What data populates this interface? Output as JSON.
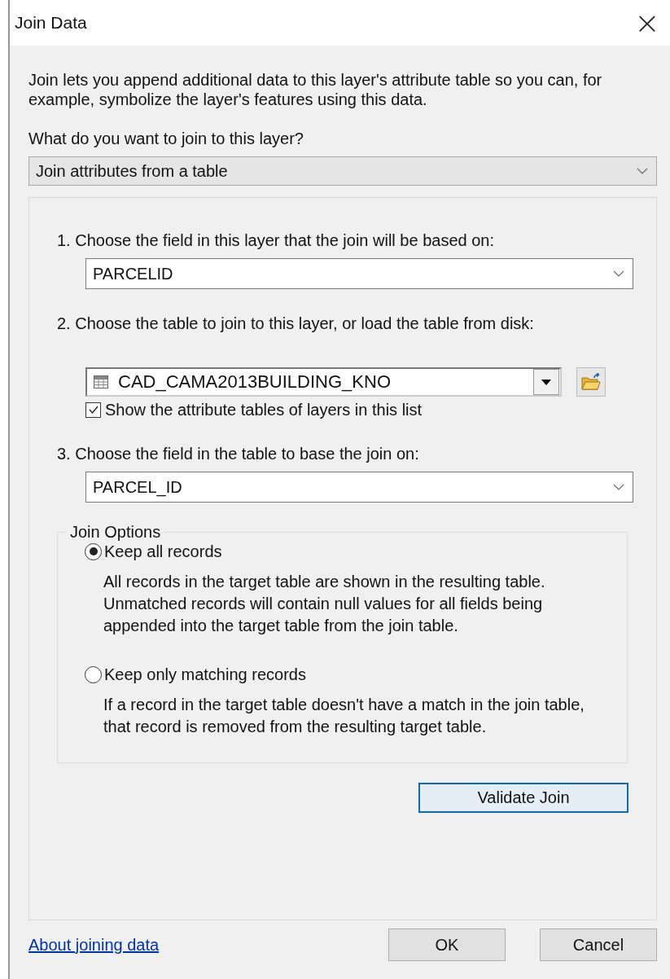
{
  "window": {
    "title": "Join Data",
    "close": "×"
  },
  "intro": "Join lets you append additional data to this layer's attribute table so you can, for example, symbolize the layer's features using this data.",
  "question": "What do you want to join to this layer?",
  "join_type": {
    "value": "Join attributes from a table"
  },
  "steps": [
    {
      "kind": "field",
      "label": "1.  Choose the field in this layer that the join will be based on:",
      "value": "PARCELID"
    },
    {
      "kind": "table",
      "label": "2.  Choose the table to join to this layer, or load the table from disk:",
      "value": "CAD_CAMA2013BUILDING_KNO",
      "checkbox": {
        "label": "Show the attribute tables of layers in this list",
        "checked": true
      }
    },
    {
      "kind": "field",
      "label": "3.  Choose the field in the table to base the join on:",
      "value": "PARCEL_ID"
    }
  ],
  "join_options": {
    "title": "Join Options",
    "options": [
      {
        "label": "Keep all records",
        "selected": true,
        "description": "All records in the target table are shown in the resulting table. Unmatched records will contain null values for all fields being appended into the target table from the join table."
      },
      {
        "label": "Keep only matching records",
        "selected": false,
        "description": "If a record in the target table doesn't have a match in the join table, that record is removed from the resulting target table."
      }
    ]
  },
  "validate_button": "Validate Join",
  "help_link": "About joining data",
  "buttons": [
    "OK",
    "Cancel"
  ]
}
